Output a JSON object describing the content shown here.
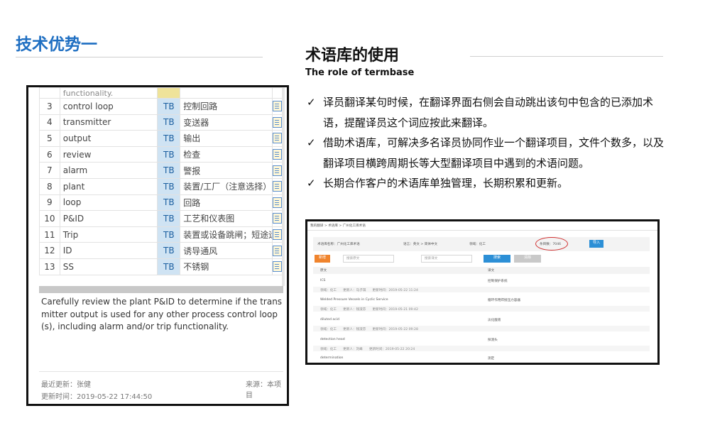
{
  "slide": {
    "title": "技术优势一",
    "section_title": "术语库的使用",
    "section_subtitle": "The role of termbase"
  },
  "bullets": [
    "译员翻译某句时候，在翻译界面右侧会自动跳出该句中包含的已添加术语，提醒译员这个词应按此来翻译。",
    "借助术语库，可解决多名译员协同作业一个翻译项目，文件个数多，以及翻译项目横跨周期长等大型翻译项目中遇到的术语问题。",
    "长期合作客户的术语库单独管理，长期积累和更新。"
  ],
  "termbase_panel": {
    "partial_row": "functionality.",
    "rows": [
      {
        "num": "3",
        "source": "control loop",
        "tag": "TB",
        "target": "控制回路"
      },
      {
        "num": "4",
        "source": "transmitter",
        "tag": "TB",
        "target": "变送器"
      },
      {
        "num": "5",
        "source": "output",
        "tag": "TB",
        "target": "输出"
      },
      {
        "num": "6",
        "source": "review",
        "tag": "TB",
        "target": "检查"
      },
      {
        "num": "7",
        "source": "alarm",
        "tag": "TB",
        "target": "警报"
      },
      {
        "num": "8",
        "source": "plant",
        "tag": "TB",
        "target": "装置/工厂（注意选择）"
      },
      {
        "num": "9",
        "source": "loop",
        "tag": "TB",
        "target": "回路"
      },
      {
        "num": "10",
        "source": "P&ID",
        "tag": "TB",
        "target": "工艺和仪表图"
      },
      {
        "num": "11",
        "source": "Trip",
        "tag": "TB",
        "target": "装置或设备跳闸；短途运输"
      },
      {
        "num": "12",
        "source": "ID",
        "tag": "TB",
        "target": "诱导通风"
      },
      {
        "num": "13",
        "source": "SS",
        "tag": "TB",
        "target": "不锈钢"
      }
    ],
    "description": "Carefully review the plant P&ID to determine if the transmitter output is used for any other process control loop(s), including alarm and/or trip functionality.",
    "last_updated_by": "最近更新：张健",
    "source": "来源：本项目",
    "updated_time": "更新时间：2019-05-22 17:44:50"
  },
  "termbase_manager": {
    "breadcrumb": "我的翻译 > 术语库 > 广州化工库术语",
    "filter_name": "术语库名称：广州化工库术语",
    "filter_lang": "语言：英文 > 简体中文",
    "filter_domain": "领域：化工",
    "entry_count": "条目数：7046",
    "import_button": "导入",
    "add_button": "新增",
    "search_source_placeholder": "搜索原文",
    "search_target_placeholder": "搜索译文",
    "search_button": "搜索",
    "clear_button": "清除",
    "col_source": "原文",
    "col_target": "译文",
    "entries": [
      {
        "source": "ICS",
        "target": "控制保护系统",
        "meta": "领域：化工　　更新人：马子琪　　更新时间：2019-05-22 11:24"
      },
      {
        "source": "Welded Pressure Vessels in Cyclic Service",
        "target": "循环作用焊接压力容器",
        "meta": "领域：化工　　更新人：钱淑芬　　更新时间：2019-05-21 09:42"
      },
      {
        "source": "diluted acid",
        "target": "淡化酸液",
        "meta": "领域：化工　　更新人：钱淑芬　　更新时间：2019-05-22 09:28"
      },
      {
        "source": "detection head",
        "target": "探测头",
        "meta": "领域：化工　　更新人：刘峰　　更新时间：2019-05-22 20:24"
      },
      {
        "source": "determination",
        "target": "测定",
        "meta": ""
      }
    ]
  }
}
